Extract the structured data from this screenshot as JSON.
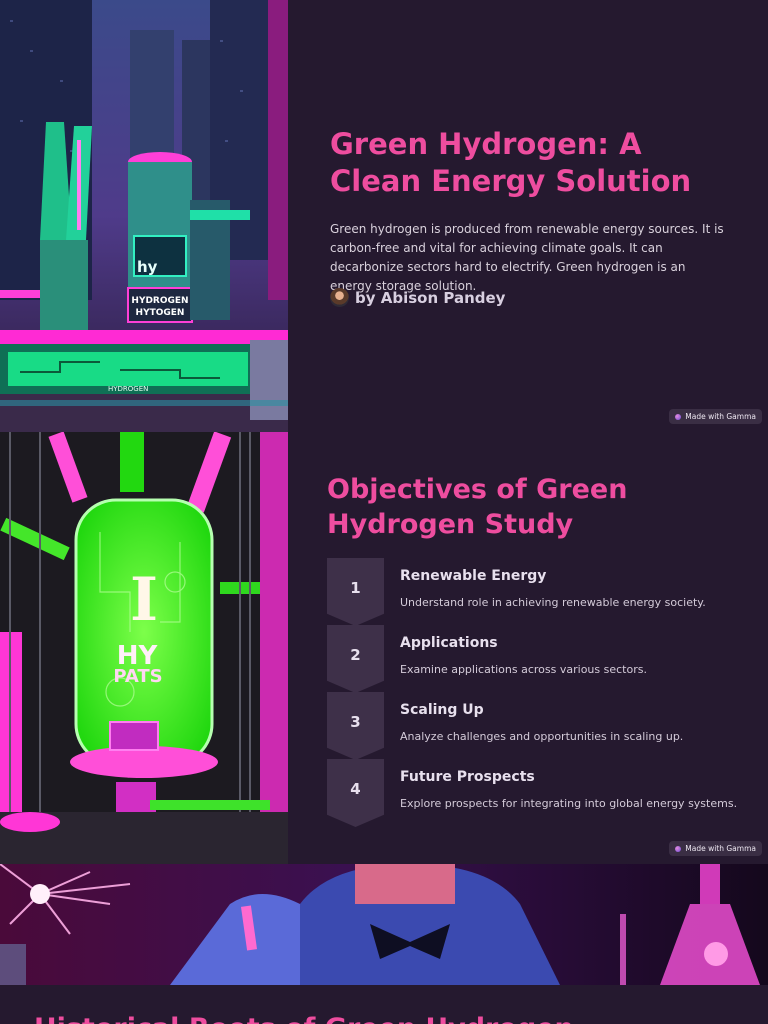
{
  "slide1": {
    "title": "Green Hydrogen: A Clean Energy Solution",
    "description": "Green hydrogen is produced from renewable energy sources. It is carbon-free and vital for achieving climate goals. It can decarbonize sectors hard to electrify. Green hydrogen is an energy storage solution.",
    "author": "by Abison Pandey",
    "badge": "Made with Gamma",
    "art": {
      "text_top": "hy",
      "label_line1": "HYDROGEN",
      "label_line2": "HYTOGEN",
      "label_small": "HYDROGEN"
    }
  },
  "slide2": {
    "title": "Objectives of Green Hydrogen Study",
    "badge": "Made with Gamma",
    "art": {
      "tank_letter": "I",
      "tank_line1": "HY",
      "tank_line2": "PATS"
    },
    "objectives": [
      {
        "number": "1",
        "heading": "Renewable Energy",
        "description": "Understand role in achieving renewable energy society."
      },
      {
        "number": "2",
        "heading": "Applications",
        "description": "Examine applications across various sectors."
      },
      {
        "number": "3",
        "heading": "Scaling Up",
        "description": "Analyze challenges and opportunities in scaling up."
      },
      {
        "number": "4",
        "heading": "Future Prospects",
        "description": "Explore prospects for integrating into global energy systems."
      }
    ]
  },
  "slide3": {
    "title": "Historical Roots of Green Hydrogen"
  },
  "colors": {
    "background": "#25192f",
    "accent": "#ee4d9f",
    "chevron": "#3e3049"
  }
}
